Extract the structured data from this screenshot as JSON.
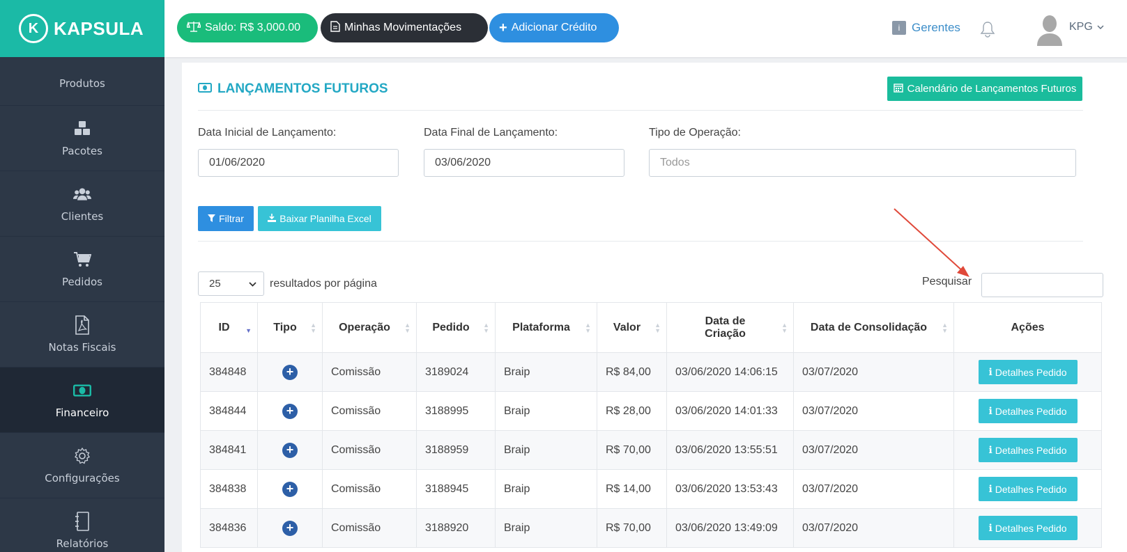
{
  "brand": {
    "logo_letter": "K",
    "name": "KAPSULA"
  },
  "sidebar": {
    "items": [
      {
        "label": "Produtos",
        "icon": "box-icon"
      },
      {
        "label": "Pacotes",
        "icon": "cubes-icon"
      },
      {
        "label": "Clientes",
        "icon": "users-icon"
      },
      {
        "label": "Pedidos",
        "icon": "cart-icon"
      },
      {
        "label": "Notas Fiscais",
        "icon": "pdf-file-icon"
      },
      {
        "label": "Financeiro",
        "icon": "money-icon",
        "active": true
      },
      {
        "label": "Configurações",
        "icon": "gear-icon"
      },
      {
        "label": "Relatórios",
        "icon": "notebook-icon"
      }
    ]
  },
  "topbar": {
    "saldo": "Saldo: R$ 3,000.00",
    "movimentacoes": "Minhas Movimentações",
    "adicionar": "Adicionar Crédito",
    "gerentes": "Gerentes",
    "user": "KPG"
  },
  "page": {
    "title": "LANÇAMENTOS FUTUROS",
    "calendar_button": "Calendário de Lançamentos Futuros",
    "filters": {
      "data_inicial_label": "Data Inicial de Lançamento:",
      "data_inicial_value": "01/06/2020",
      "data_final_label": "Data Final de Lançamento:",
      "data_final_value": "03/06/2020",
      "tipo_label": "Tipo de Operação:",
      "tipo_placeholder": "Todos"
    },
    "filtrar_button": "Filtrar",
    "excel_button": "Baixar Planilha Excel",
    "per_page_value": "25",
    "per_page_label": "resultados por página",
    "search_label": "Pesquisar"
  },
  "table": {
    "headers": [
      "ID",
      "Tipo",
      "Operação",
      "Pedido",
      "Plataforma",
      "Valor",
      "Data de Criação",
      "Data de Consolidação",
      "Ações"
    ],
    "action_label": "Detalhes Pedido",
    "rows": [
      {
        "id": "384848",
        "operacao": "Comissão",
        "pedido": "3189024",
        "plataforma": "Braip",
        "valor": "R$ 84,00",
        "criacao": "03/06/2020 14:06:15",
        "consolidacao": "03/07/2020"
      },
      {
        "id": "384844",
        "operacao": "Comissão",
        "pedido": "3188995",
        "plataforma": "Braip",
        "valor": "R$ 28,00",
        "criacao": "03/06/2020 14:01:33",
        "consolidacao": "03/07/2020"
      },
      {
        "id": "384841",
        "operacao": "Comissão",
        "pedido": "3188959",
        "plataforma": "Braip",
        "valor": "R$ 70,00",
        "criacao": "03/06/2020 13:55:51",
        "consolidacao": "03/07/2020"
      },
      {
        "id": "384838",
        "operacao": "Comissão",
        "pedido": "3188945",
        "plataforma": "Braip",
        "valor": "R$ 14,00",
        "criacao": "03/06/2020 13:53:43",
        "consolidacao": "03/07/2020"
      },
      {
        "id": "384836",
        "operacao": "Comissão",
        "pedido": "3188920",
        "plataforma": "Braip",
        "valor": "R$ 70,00",
        "criacao": "03/06/2020 13:49:09",
        "consolidacao": "03/07/2020"
      }
    ]
  },
  "colors": {
    "brand": "#1bbaa6",
    "sidebar": "#2d3847",
    "accent": "#23a8c4",
    "annotation_arrow": "#e0493a"
  }
}
